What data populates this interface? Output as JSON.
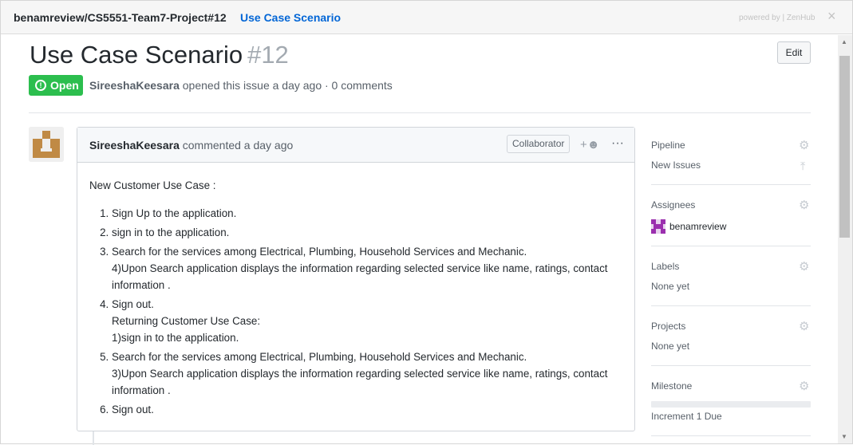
{
  "header": {
    "repo": "benamreview/CS5551-Team7-Project#12",
    "crumb": "Use Case Scenario",
    "powered": "powered by | ZenHub",
    "close": "×"
  },
  "issue": {
    "title": "Use Case Scenario",
    "number": "#12",
    "edit_label": "Edit",
    "status": "Open",
    "author": "SireeshaKeesara",
    "meta_rest": " opened this issue a day ago · 0 comments"
  },
  "comment": {
    "author": "SireeshaKeesara",
    "when": " commented a day ago",
    "badge": "Collaborator",
    "react": "+☻",
    "more": "···",
    "intro": "New Customer Use Case :",
    "items": [
      {
        "text": "Sign Up to the application."
      },
      {
        "text": "sign in to the application."
      },
      {
        "text": "Search for the services among Electrical, Plumbing, Household Services and Mechanic.",
        "extra": "4)Upon Search application displays the information regarding selected service like name, ratings, contact information ."
      },
      {
        "text": "Sign out.",
        "extra": "Returning Customer Use Case:",
        "extra2": "1)sign in to the application."
      },
      {
        "text": "Search for the services among Electrical, Plumbing, Household Services and Mechanic.",
        "extra": "3)Upon Search application displays the information regarding selected service like name, ratings, contact information ."
      },
      {
        "text": "Sign out."
      }
    ]
  },
  "sidebar": {
    "pipeline": {
      "label": "Pipeline",
      "value": "New Issues"
    },
    "assignees": {
      "label": "Assignees",
      "value": "benamreview"
    },
    "labels": {
      "label": "Labels",
      "value": "None yet"
    },
    "projects": {
      "label": "Projects",
      "value": "None yet"
    },
    "milestone": {
      "label": "Milestone",
      "value": "Increment 1 Due",
      "progress": 0
    }
  },
  "icons": {
    "gear": "gear-icon",
    "open": "issue-opened-icon",
    "pin": "move-to-top-icon",
    "smiley": "smiley-icon"
  },
  "colors": {
    "open": "#2cbe4e",
    "link": "#0366d6",
    "avatar_assignee": "#9b2fae",
    "avatar_author": "#c08a45"
  }
}
